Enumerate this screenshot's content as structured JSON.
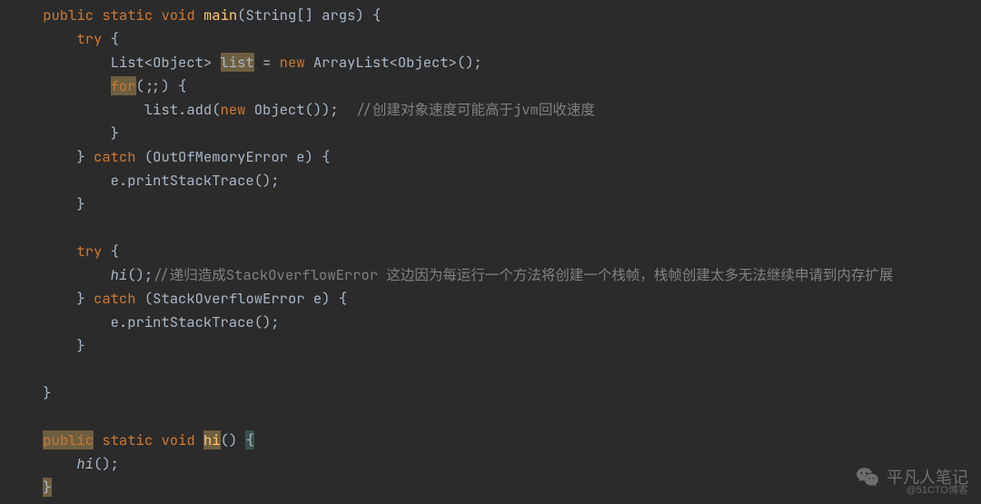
{
  "code": {
    "k_public": "public",
    "k_static": "static",
    "k_void": "void",
    "k_try": "try",
    "k_catch": "catch",
    "k_new": "new",
    "k_for": "for",
    "m_main": "main",
    "m_hi": "hi",
    "sig_main_params": "(String[] args) {",
    "line_try_open": " {",
    "decl_list_prefix": "List<Object>",
    "decl_list_var": "list",
    "decl_list_rest": " = ",
    "decl_list_new": "ArrayList<Object>();",
    "for_head": "(;;) {",
    "list_add_prefix": "list.add(",
    "list_add_new": "Object());",
    "cmt1": "  //创建对象速度可能高于jvm回收速度",
    "close_brace": "}",
    "catch1_sig": " (OutOfMemoryError e) {",
    "print_trace": "e.printStackTrace();",
    "call_hi": "hi",
    "call_hi_tail": "();",
    "cmt2": "//递归造成StackOverflowError 这边因为每运行一个方法将创建一个栈帧，栈帧创建太多无法继续申请到内存扩展",
    "catch2_sig": " (StackOverflowError e) {",
    "hi_sig_open": "() ",
    "hi_sig_brace": "{",
    "call_hi2": "hi",
    "call_hi2_tail": "();",
    "final_brace": "}"
  },
  "watermark": {
    "text": "平凡人笔记"
  },
  "attribution": "@51CTO博客"
}
